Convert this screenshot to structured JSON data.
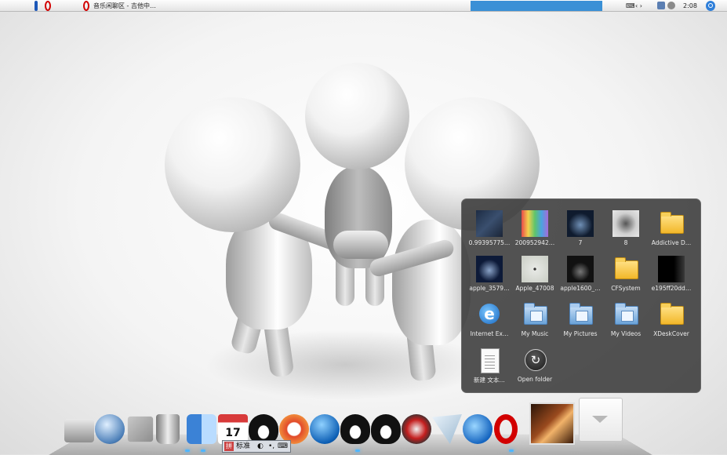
{
  "menubar": {
    "window_title": "音乐闲聊区 - 吉他中…",
    "nav_arrows": "‹ ›",
    "time": "2:08",
    "apple_glyph": "",
    "accent": "#2f7fd9"
  },
  "stack": {
    "items": [
      {
        "label": "0.99395775…",
        "kind": "photo-dark"
      },
      {
        "label": "200952942…",
        "kind": "photo-drip"
      },
      {
        "label": "7",
        "kind": "photo-apple-dark"
      },
      {
        "label": "8",
        "kind": "photo-apple-gray"
      },
      {
        "label": "Addictive D…",
        "kind": "folder"
      },
      {
        "label": "apple_3579…",
        "kind": "photo-apple-navy"
      },
      {
        "label": "Apple_47008",
        "kind": "photo-apple-light"
      },
      {
        "label": "apple1600_…",
        "kind": "photo-apple-black"
      },
      {
        "label": "CFSystem",
        "kind": "folder"
      },
      {
        "label": "e195ff20dd…",
        "kind": "photo-black"
      },
      {
        "label": "Internet Ex…",
        "kind": "ie"
      },
      {
        "label": "My Music",
        "kind": "bluefolder"
      },
      {
        "label": "My Pictures",
        "kind": "bluefolder"
      },
      {
        "label": "My Videos",
        "kind": "bluefolder"
      },
      {
        "label": "XDeskCover",
        "kind": "folder"
      },
      {
        "label": "新建 文本…",
        "kind": "doc"
      },
      {
        "label": "Open folder",
        "kind": "open-folder"
      }
    ]
  },
  "dock": {
    "icons": [
      "hard-drive",
      "network-globe",
      "network-computers",
      "trash",
      "finder",
      "calendar",
      "qq-penguin",
      "media-player",
      "play-button",
      "qq-penguin",
      "qq-penguin",
      "cf-game",
      "cursor-app",
      "internet-explorer",
      "opera",
      "xdeskcover",
      "stack-trash"
    ],
    "calendar_day": "17",
    "ime_text": "标准"
  }
}
